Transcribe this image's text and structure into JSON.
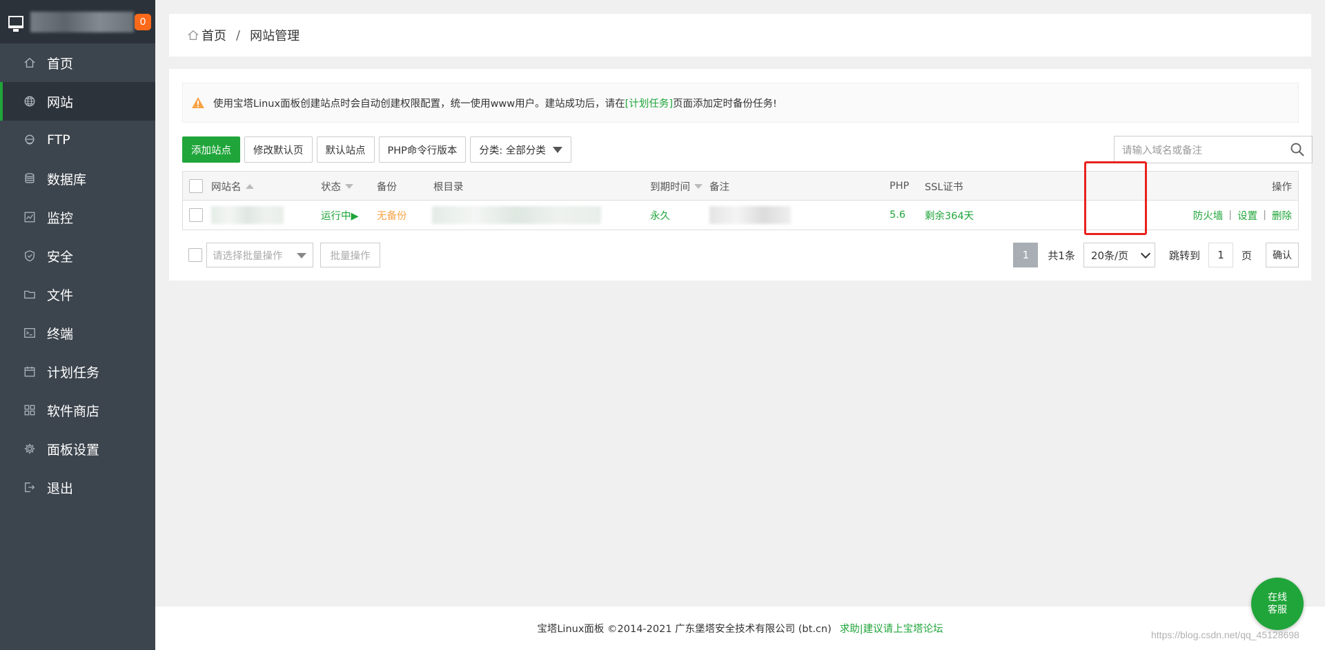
{
  "sidebar": {
    "badge": "0",
    "items": [
      {
        "label": "首页",
        "icon": "home-icon"
      },
      {
        "label": "网站",
        "icon": "globe-icon",
        "active": true
      },
      {
        "label": "FTP",
        "icon": "ftp-icon"
      },
      {
        "label": "数据库",
        "icon": "database-icon"
      },
      {
        "label": "监控",
        "icon": "monitor-chart-icon"
      },
      {
        "label": "安全",
        "icon": "shield-icon"
      },
      {
        "label": "文件",
        "icon": "folder-icon"
      },
      {
        "label": "终端",
        "icon": "terminal-icon"
      },
      {
        "label": "计划任务",
        "icon": "calendar-icon"
      },
      {
        "label": "软件商店",
        "icon": "grid-icon"
      },
      {
        "label": "面板设置",
        "icon": "gear-icon"
      },
      {
        "label": "退出",
        "icon": "logout-icon"
      }
    ]
  },
  "breadcrumb": {
    "home": "首页",
    "separator": "/",
    "current": "网站管理"
  },
  "alert": {
    "text_before": "使用宝塔Linux面板创建站点时会自动创建权限配置，统一使用www用户。建站成功后，请在",
    "link": "[计划任务]",
    "text_after": "页面添加定时备份任务!"
  },
  "toolbar": {
    "add_site": "添加站点",
    "edit_default_page": "修改默认页",
    "default_site": "默认站点",
    "php_cli_version": "PHP命令行版本",
    "category": "分类: 全部分类"
  },
  "search": {
    "placeholder": "请输入域名或备注"
  },
  "table": {
    "headers": {
      "name": "网站名",
      "status": "状态",
      "backup": "备份",
      "root": "根目录",
      "expire": "到期时间",
      "remark": "备注",
      "php": "PHP",
      "ssl": "SSL证书",
      "ops": "操作"
    },
    "rows": [
      {
        "status": "运行中▶",
        "backup": "无备份",
        "expire": "永久",
        "php": "5.6",
        "ssl": "剩余364天",
        "ops": [
          "防火墙",
          "设置",
          "删除"
        ]
      }
    ]
  },
  "batch": {
    "placeholder": "请选择批量操作",
    "button": "批量操作"
  },
  "pager": {
    "current": "1",
    "total": "共1条",
    "page_size": "20条/页",
    "jump_label": "跳转到",
    "jump_value": "1",
    "page_unit": "页",
    "confirm": "确认"
  },
  "footer": {
    "copyright": "宝塔Linux面板 ©2014-2021 广东堡塔安全技术有限公司 (bt.cn)",
    "link": "求助|建议请上宝塔论坛"
  },
  "service_button": {
    "line1": "在线",
    "line2": "客服"
  },
  "watermark": "https://blog.csdn.net/qq_45128698",
  "colors": {
    "accent": "#20a53a",
    "sidebar": "#3c444d",
    "warning": "#f7a346",
    "highlight": "#e8211c"
  }
}
